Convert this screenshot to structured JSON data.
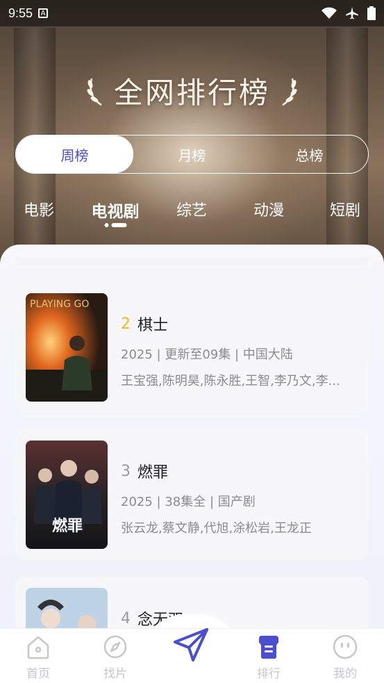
{
  "status": {
    "time": "9:55",
    "a_badge": "A"
  },
  "header": {
    "title": "全网排行榜"
  },
  "period_tabs": [
    {
      "label": "周榜",
      "active": true
    },
    {
      "label": "月榜",
      "active": false
    },
    {
      "label": "总榜",
      "active": false
    }
  ],
  "categories": [
    {
      "label": "电影"
    },
    {
      "label": "电视剧",
      "active": true
    },
    {
      "label": "综艺"
    },
    {
      "label": "动漫"
    },
    {
      "label": "短剧"
    }
  ],
  "items": [
    {
      "rank": "2",
      "title": "棋士",
      "meta": "2025 | 更新至09集 | 中国大陆",
      "cast": "王宝强,陈明昊,陈永胜,王智,李乃文,李...",
      "poster_text": "PLAYING GO"
    },
    {
      "rank": "3",
      "title": "燃罪",
      "meta": "2025 | 38集全 | 国产剧",
      "cast": "张云龙,蔡文静,代旭,涂松岩,王龙正",
      "poster_text": "燃罪"
    },
    {
      "rank": "4",
      "title": "念无双",
      "meta": "",
      "cast": ""
    }
  ],
  "tabbar": [
    {
      "label": "首页",
      "icon": "home-icon"
    },
    {
      "label": "找片",
      "icon": "compass-icon"
    },
    {
      "label": "",
      "icon": "send-icon"
    },
    {
      "label": "排行",
      "icon": "ranking-icon",
      "active": true
    },
    {
      "label": "我的",
      "icon": "profile-icon"
    }
  ],
  "colors": {
    "accent": "#4a4fd0",
    "gold": "#f0b91d"
  }
}
